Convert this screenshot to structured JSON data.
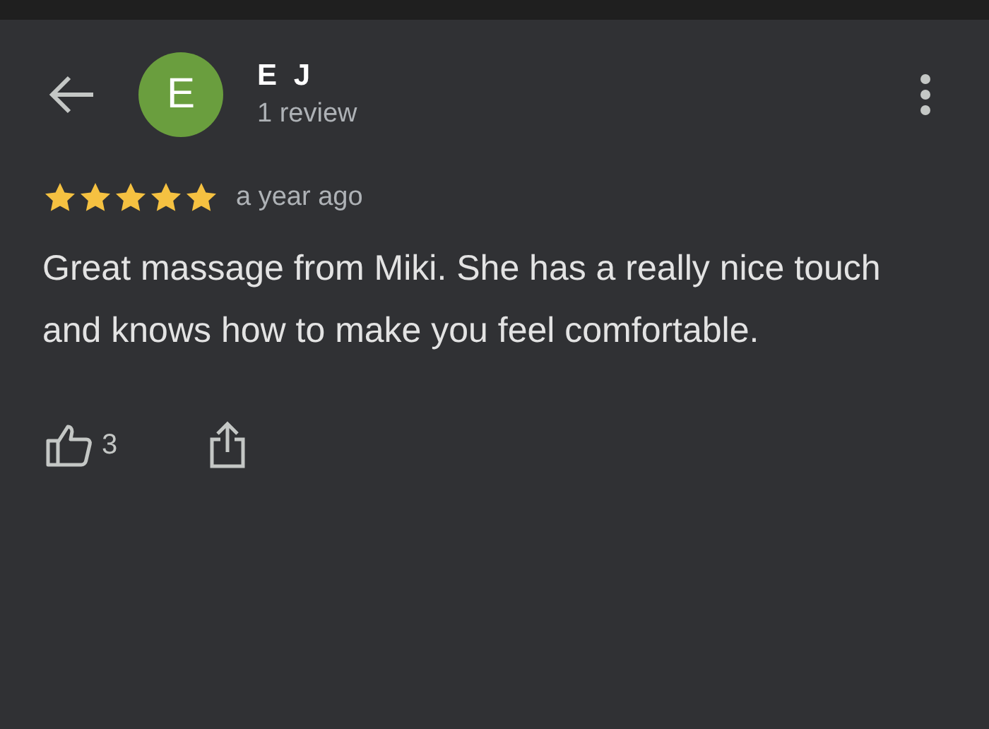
{
  "reviewer": {
    "initial": "E",
    "name": "E J",
    "review_count": "1 review"
  },
  "review": {
    "stars": 5,
    "time": "a year ago",
    "text": "Great massage from Miki. She has a really nice touch and knows how to make you feel comfortable."
  },
  "actions": {
    "like_count": "3"
  }
}
